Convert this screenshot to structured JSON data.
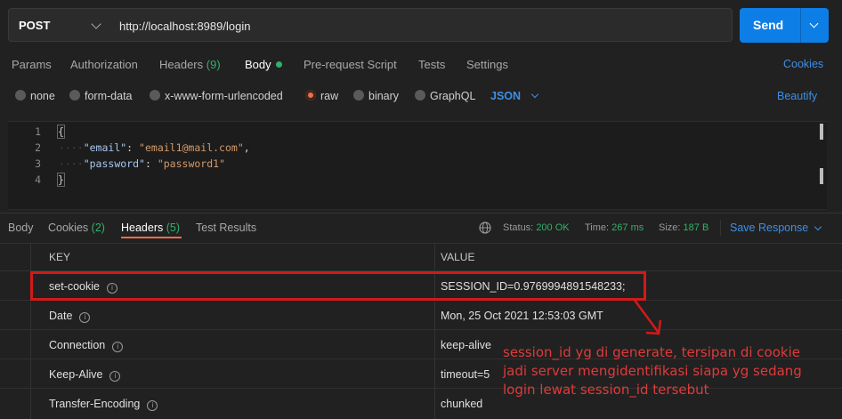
{
  "request": {
    "method": "POST",
    "url": "http://localhost:8989/login",
    "send_label": "Send"
  },
  "request_tabs": [
    {
      "label": "Params"
    },
    {
      "label": "Authorization"
    },
    {
      "label": "Headers",
      "count": "(9)"
    },
    {
      "label": "Body"
    },
    {
      "label": "Pre-request Script"
    },
    {
      "label": "Tests"
    },
    {
      "label": "Settings"
    }
  ],
  "cookies_link": "Cookies",
  "body_types": [
    "none",
    "form-data",
    "x-www-form-urlencoded",
    "raw",
    "binary",
    "GraphQL"
  ],
  "body_format": "JSON",
  "beautify_label": "Beautify",
  "editor": {
    "line_numbers": [
      "1",
      "2",
      "3",
      "4"
    ],
    "open_brace": "{",
    "close_brace": "}",
    "email_key": "\"email\"",
    "email_value": "\"email1@mail.com\"",
    "password_key": "\"password\"",
    "password_value": "\"password1\""
  },
  "response_tabs": [
    {
      "label": "Body"
    },
    {
      "label": "Cookies",
      "count": "(2)"
    },
    {
      "label": "Headers",
      "count": "(5)"
    },
    {
      "label": "Test Results"
    }
  ],
  "status": {
    "status_label": "Status:",
    "status_value": "200 OK",
    "time_label": "Time:",
    "time_value": "267 ms",
    "size_label": "Size:",
    "size_value": "187 B"
  },
  "save_response_label": "Save Response",
  "headers_table": {
    "columns": [
      "KEY",
      "VALUE"
    ],
    "rows": [
      {
        "key": "set-cookie",
        "value": "SESSION_ID=0.9769994891548233;"
      },
      {
        "key": "Date",
        "value": "Mon, 25 Oct 2021 12:53:03 GMT"
      },
      {
        "key": "Connection",
        "value": "keep-alive"
      },
      {
        "key": "Keep-Alive",
        "value": "timeout=5"
      },
      {
        "key": "Transfer-Encoding",
        "value": "chunked"
      }
    ]
  },
  "annotation": {
    "line1": "session_id yg di generate, tersipan di cookie",
    "line2": "jadi server mengidentifikasi siapa yg sedang",
    "line3": "login lewat session_id tersebut"
  },
  "colors": {
    "accent": "#ef6e4a",
    "send_button": "#0d7ee6",
    "success": "#2fb36b",
    "link": "#3d8fe8",
    "annotation": "#d11a1a"
  }
}
